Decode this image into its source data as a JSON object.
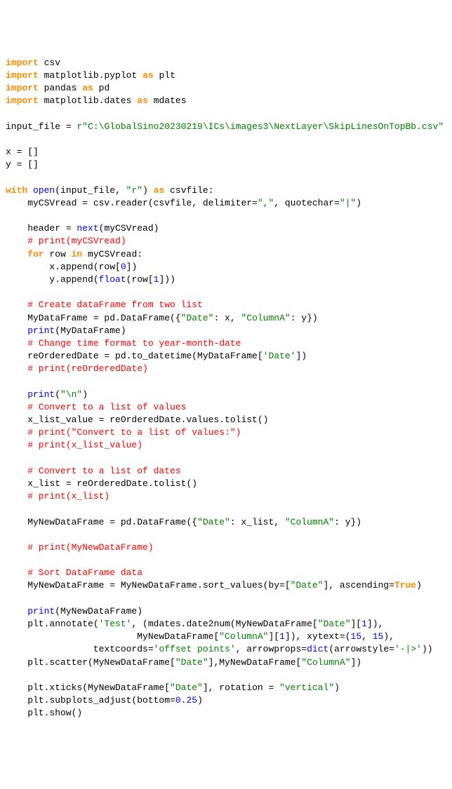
{
  "code": {
    "l1_import": "import",
    "l1_mod": "csv",
    "l2_import": "import",
    "l2_mod": "matplotlib.pyplot",
    "l2_as": "as",
    "l2_alias": "plt",
    "l3_import": "import",
    "l3_mod": "pandas",
    "l3_as": "as",
    "l3_alias": "pd",
    "l4_import": "import",
    "l4_mod": "matplotlib.dates",
    "l4_as": "as",
    "l4_alias": "mdates",
    "l6_var": "input_file = ",
    "l6_prefix": "r",
    "l6_str": "\"C:\\GlobalSino20230219\\ICs\\images3\\NextLayer\\SkipLinesOnTopBb.csv\"",
    "l8": "x = []",
    "l9": "y = []",
    "l11_with": "with",
    "l11_open": "open",
    "l11_a": "(input_file, ",
    "l11_str": "\"r\"",
    "l11_b": ") ",
    "l11_as": "as",
    "l11_c": " csvfile:",
    "l12_a": "    myCSVread = csv.reader(csvfile, delimiter=",
    "l12_s1": "\",\"",
    "l12_b": ", quotechar=",
    "l12_s2": "\"|\"",
    "l12_c": ")",
    "l14_a": "    header = ",
    "l14_next": "next",
    "l14_b": "(myCSVread)",
    "l15": "    # print(myCSVread)",
    "l16_for": "    for",
    "l16_a": " row ",
    "l16_in": "in",
    "l16_b": " myCSVread:",
    "l17_a": "        x.append(row[",
    "l17_n": "0",
    "l17_b": "])",
    "l18_a": "        y.append(",
    "l18_float": "float",
    "l18_b": "(row[",
    "l18_n": "1",
    "l18_c": "]))",
    "l20": "    # Create dataFrame from two list",
    "l21_a": "    MyDataFrame = pd.DataFrame({",
    "l21_s1": "\"Date\"",
    "l21_b": ": x, ",
    "l21_s2": "\"ColumnA\"",
    "l21_c": ": y})",
    "l22_print": "    print",
    "l22_a": "(MyDataFrame)",
    "l23": "    # Change time format to year-month-date",
    "l24_a": "    reOrderedDate = pd.to_datetime(MyDataFrame[",
    "l24_s": "'Date'",
    "l24_b": "])",
    "l25": "    # print(reOrderedDate)",
    "l27_print": "    print",
    "l27_a": "(",
    "l27_s": "\"\\n\"",
    "l27_b": ")",
    "l28": "    # Convert to a list of values",
    "l29": "    x_list_value = reOrderedDate.values.tolist()",
    "l30": "    # print(\"Convert to a list of values:\")",
    "l31": "    # print(x_list_value)",
    "l33": "    # Convert to a list of dates",
    "l34": "    x_list = reOrderedDate.tolist()",
    "l35": "    # print(x_list)",
    "l37_a": "    MyNewDataFrame = pd.DataFrame({",
    "l37_s1": "\"Date\"",
    "l37_b": ": x_list, ",
    "l37_s2": "\"ColumnA\"",
    "l37_c": ": y})",
    "l39": "    # print(MyNewDataFrame)",
    "l41": "    # Sort DataFrame data",
    "l42_a": "    MyNewDataFrame = MyNewDataFrame.sort_values(by=[",
    "l42_s": "\"Date\"",
    "l42_b": "], ascending=",
    "l42_t": "True",
    "l42_c": ")",
    "l44_print": "    print",
    "l44_a": "(MyNewDataFrame)",
    "l45_a": "    plt.annotate(",
    "l45_s1": "'Test'",
    "l45_b": ", (mdates.date2num(MyNewDataFrame[",
    "l45_s2": "\"Date\"",
    "l45_c": "][",
    "l45_n1": "1",
    "l45_d": "]),",
    "l46_a": "                        MyNewDataFrame[",
    "l46_s": "\"ColumnA\"",
    "l46_b": "][",
    "l46_n": "1",
    "l46_c": "]), xytext=(",
    "l46_n2": "15",
    "l46_d": ", ",
    "l46_n3": "15",
    "l46_e": "),",
    "l47_a": "                textcoords=",
    "l47_s1": "'offset points'",
    "l47_b": ", arrowprops=",
    "l47_dict": "dict",
    "l47_c": "(arrowstyle=",
    "l47_s2": "'-|>'",
    "l47_d": "))",
    "l48_a": "    plt.scatter(MyNewDataFrame[",
    "l48_s1": "\"Date\"",
    "l48_b": "],MyNewDataFrame[",
    "l48_s2": "\"ColumnA\"",
    "l48_c": "])",
    "l50_a": "    plt.xticks(MyNewDataFrame[",
    "l50_s1": "\"Date\"",
    "l50_b": "], rotation = ",
    "l50_s2": "\"vertical\"",
    "l50_c": ")",
    "l51_a": "    plt.subplots_adjust(bottom=",
    "l51_n": "0.25",
    "l51_b": ")",
    "l52": "    plt.show()"
  }
}
